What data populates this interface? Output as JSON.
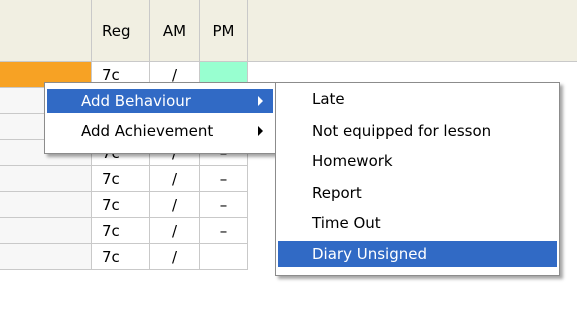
{
  "grid": {
    "headers": {
      "reg": "Reg",
      "am": "AM",
      "pm": "PM"
    },
    "rows": [
      {
        "reg": "7c",
        "am": "/",
        "pm": ""
      },
      {
        "reg": "7c",
        "am": "/",
        "pm": ""
      },
      {
        "reg": "7c",
        "am": "/",
        "pm": ""
      },
      {
        "reg": "7c",
        "am": "/",
        "pm": "–"
      },
      {
        "reg": "7c",
        "am": "/",
        "pm": "–"
      },
      {
        "reg": "7c",
        "am": "/",
        "pm": "–"
      },
      {
        "reg": "7c",
        "am": "/",
        "pm": "–"
      },
      {
        "reg": "7c",
        "am": "/",
        "pm": ""
      }
    ]
  },
  "context_menu": {
    "items": [
      {
        "label": "Add Behaviour",
        "selected": true
      },
      {
        "label": "Add Achievement",
        "selected": false
      }
    ]
  },
  "submenu": {
    "items": [
      {
        "label": "Late"
      },
      {
        "label": "Not equipped for lesson"
      },
      {
        "label": "Homework"
      },
      {
        "label": "Report"
      },
      {
        "label": "Time Out"
      },
      {
        "label": "Diary Unsigned",
        "selected": true
      }
    ]
  },
  "colors": {
    "selection": "#316ac5",
    "highlight_row": "#f7a224",
    "pm_mark": "#98ffd0"
  }
}
